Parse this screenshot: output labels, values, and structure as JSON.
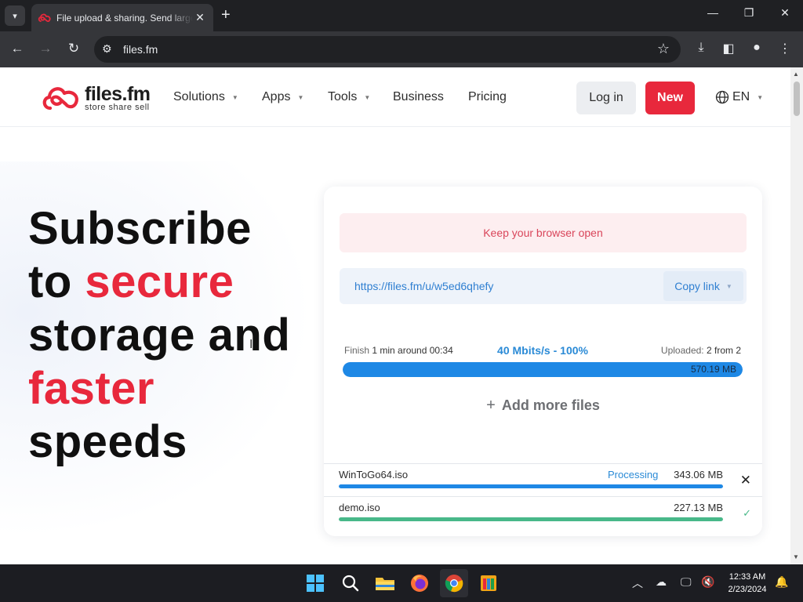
{
  "browser": {
    "tab_title": "File upload & sharing. Send large files",
    "new_tab": "+",
    "tab_close": "✕",
    "url": "files.fm",
    "window_minimize": "—",
    "window_restore": "❐",
    "window_close": "✕"
  },
  "site": {
    "logo_text": "files.fm",
    "logo_tagline": "store share sell",
    "nav": {
      "solutions": "Solutions",
      "apps": "Apps",
      "tools": "Tools",
      "business": "Business",
      "pricing": "Pricing"
    },
    "login_label": "Log in",
    "new_label": "New",
    "language": "EN"
  },
  "hero": {
    "line1": "Subscribe",
    "line2a": "to ",
    "line2b": "secure",
    "line3": "storage and",
    "line4": "faster",
    "line5": "speeds"
  },
  "upload": {
    "warning": "Keep your browser open",
    "share_url": "https://files.fm/u/w5ed6qhefy",
    "copy_label": "Copy link",
    "finish_label": "Finish",
    "finish_value": "1 min around 00:34",
    "speed": "40 Mbits/s - 100%",
    "uploaded_label": "Uploaded:",
    "uploaded_value": "2 from 2",
    "total_size": "570.19 MB",
    "progress_fraction": 1.0,
    "add_more": "Add more files",
    "files": [
      {
        "name": "WinToGo64.iso",
        "status": "Processing",
        "size": "343.06 MB",
        "progress_fraction": 1.0,
        "bar_color": "#1e88e5",
        "action": "✕"
      },
      {
        "name": "demo.iso",
        "status": "",
        "size": "227.13 MB",
        "progress_fraction": 1.0,
        "bar_color": "#48b889",
        "action": "✓"
      }
    ]
  },
  "taskbar": {
    "time": "12:33 AM",
    "date": "2/23/2024"
  },
  "colors": {
    "brand_red": "#e8283c",
    "link_blue": "#2f7fd1",
    "progress_blue": "#1e88e5",
    "done_green": "#48b889"
  }
}
